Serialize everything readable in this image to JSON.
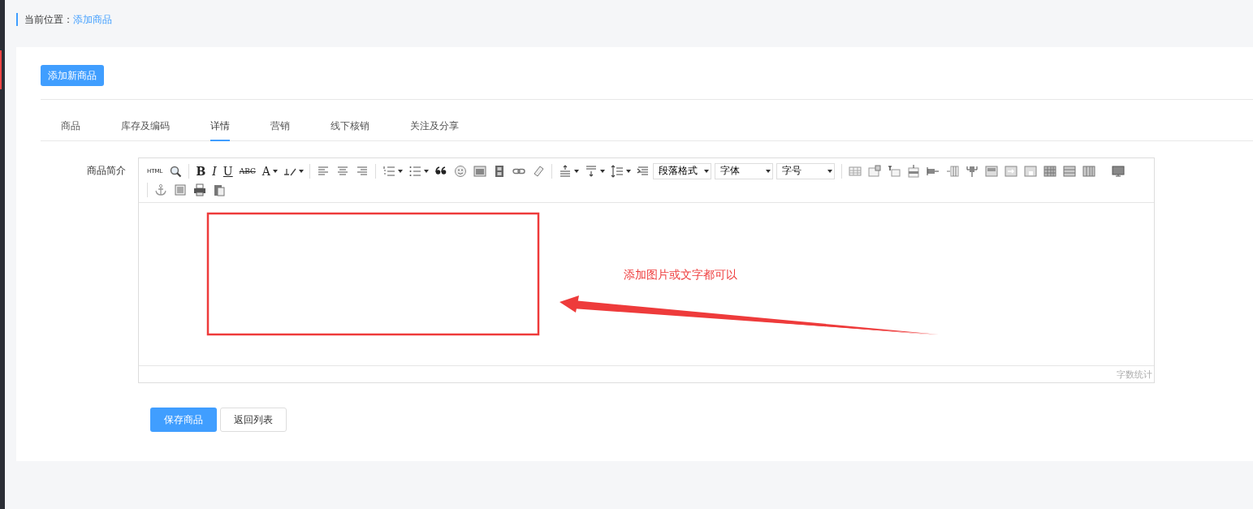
{
  "breadcrumb": {
    "label": "当前位置：",
    "current": "添加商品"
  },
  "add_button": "添加新商品",
  "tabs": [
    {
      "label": "商品",
      "selected": false
    },
    {
      "label": "库存及编码",
      "selected": false
    },
    {
      "label": "详情",
      "selected": true
    },
    {
      "label": "营销",
      "selected": false
    },
    {
      "label": "线下核销",
      "selected": false
    },
    {
      "label": "关注及分享",
      "selected": false
    }
  ],
  "field_label": "商品简介",
  "editor": {
    "text_buttons": [
      "HTML",
      "B",
      "I",
      "U",
      "ABC",
      "A"
    ],
    "selects": [
      {
        "value": "段落格式"
      },
      {
        "value": "字体"
      },
      {
        "value": "字号"
      }
    ],
    "annotation": "添加图片或文字都可以",
    "word_count": "字数统计"
  },
  "buttons": [
    {
      "label": "保存商品",
      "kind": "primary"
    },
    {
      "label": "返回列表",
      "kind": "default"
    }
  ]
}
